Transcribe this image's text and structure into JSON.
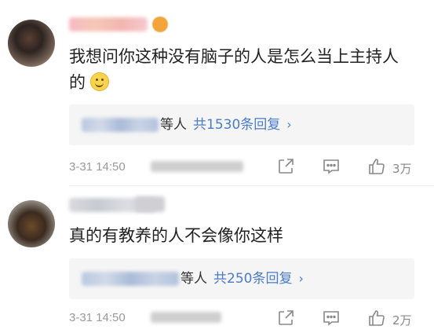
{
  "comments": [
    {
      "text": "我想问你这种没有脑子的人是怎么当上主持人的",
      "replies_deng": "等人",
      "replies_count": "共1530条回复",
      "reply_chevron": "›",
      "time": "3-31 14:50",
      "likes": "3万"
    },
    {
      "text": "真的有教养的人不会像你这样",
      "replies_deng": "等人",
      "replies_count": "共250条回复",
      "reply_chevron": "›",
      "time": "3-31 14:50",
      "likes": "2万"
    }
  ],
  "icons": {
    "share": "share-icon",
    "comment": "comment-icon",
    "like": "thumbs-up-icon",
    "emoji": "smile-emoji-icon"
  },
  "colors": {
    "link": "#4a7cc9",
    "meta": "#999999",
    "reply_box": "#f5f5f5"
  }
}
